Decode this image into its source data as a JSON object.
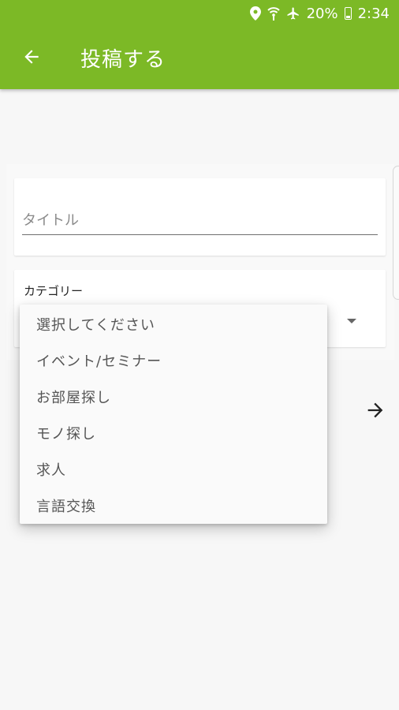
{
  "status_bar": {
    "battery": "20%",
    "time": "2:34",
    "icons": [
      "location-icon",
      "wifi-icon",
      "airplane-mode-icon",
      "battery-icon"
    ]
  },
  "toolbar": {
    "back_icon": "back-arrow-icon",
    "title": "投稿する"
  },
  "form": {
    "title_placeholder": "タイトル",
    "title_value": "",
    "category_label": "カテゴリー",
    "category_menu": [
      "選択してください",
      "イベント/セミナー",
      "お部屋探し",
      "モノ探し",
      "求人",
      "言語交換"
    ],
    "next_icon": "arrow-right-icon"
  },
  "colors": {
    "app_bar": "#7cb926",
    "background": "#f7f7f7"
  }
}
